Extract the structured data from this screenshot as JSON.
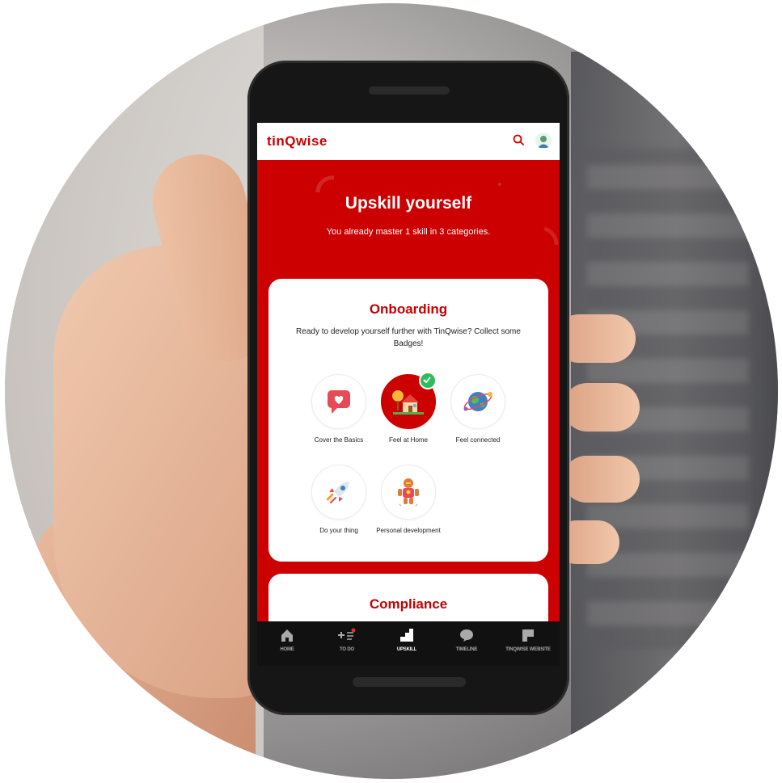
{
  "app": {
    "logo": "tinQwise"
  },
  "hero": {
    "title": "Upskill yourself",
    "subtitle": "You already master 1 skill in 3 categories."
  },
  "onboarding": {
    "title": "Onboarding",
    "description": "Ready to develop yourself further with TinQwise? Collect some Badges!",
    "badges": [
      {
        "label": "Cover the Basics",
        "icon": "chat-heart-icon",
        "completed": false
      },
      {
        "label": "Feel at Home",
        "icon": "house-icon",
        "completed": true
      },
      {
        "label": "Feel connected",
        "icon": "globe-icon",
        "completed": false
      },
      {
        "label": "Do your thing",
        "icon": "rocket-icon",
        "completed": false
      },
      {
        "label": "Personal development",
        "icon": "robot-icon",
        "completed": false
      }
    ]
  },
  "compliance": {
    "title": "Compliance"
  },
  "nav": {
    "items": [
      {
        "label": "HOME",
        "icon": "home-icon",
        "active": false
      },
      {
        "label": "TO DO",
        "icon": "todo-icon",
        "active": false
      },
      {
        "label": "UPSKILL",
        "icon": "upskill-icon",
        "active": true
      },
      {
        "label": "TIMELINE",
        "icon": "chat-icon",
        "active": false
      },
      {
        "label": "TINQWISE WEBSITE",
        "icon": "flag-icon",
        "active": false
      }
    ]
  },
  "colors": {
    "brand_red": "#cc0000",
    "check_green": "#2ebd5c",
    "nav_bg": "#111111"
  }
}
